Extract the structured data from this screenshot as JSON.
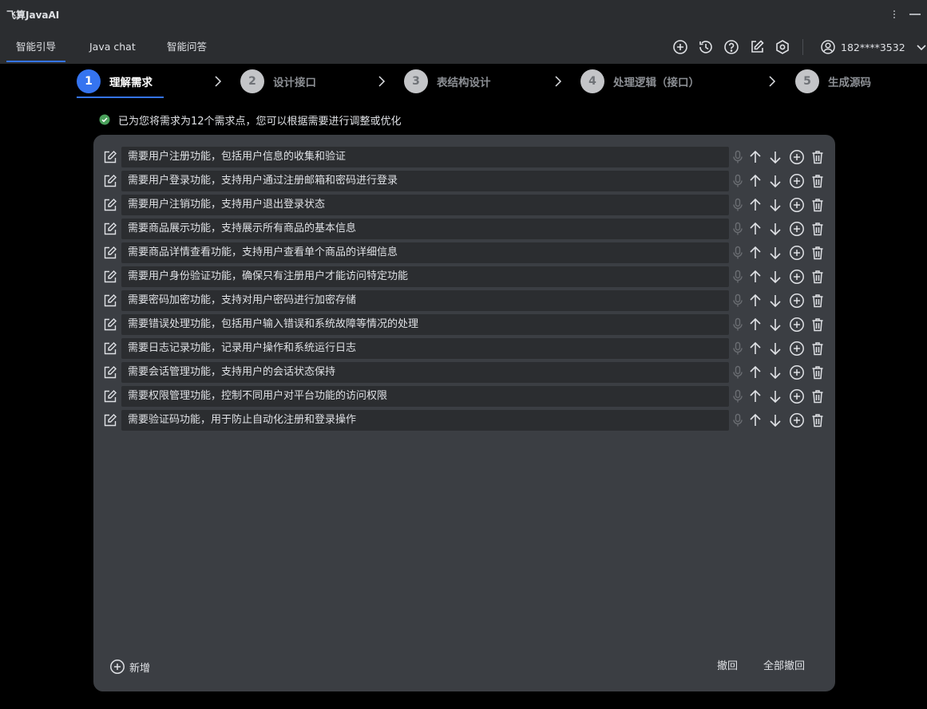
{
  "app": {
    "title": "飞算JavaAI"
  },
  "tabs": [
    {
      "label": "智能引导",
      "active": true
    },
    {
      "label": "Java chat",
      "active": false
    },
    {
      "label": "智能问答",
      "active": false
    }
  ],
  "toolbar_icons": [
    "plus-circle-icon",
    "history-icon",
    "help-icon",
    "edit-icon",
    "settings-icon"
  ],
  "user": {
    "account": "182****3532"
  },
  "steps": [
    {
      "num": "1",
      "label": "理解需求",
      "active": true
    },
    {
      "num": "2",
      "label": "设计接口",
      "active": false
    },
    {
      "num": "3",
      "label": "表结构设计",
      "active": false
    },
    {
      "num": "4",
      "label": "处理逻辑（接口）",
      "active": false
    },
    {
      "num": "5",
      "label": "生成源码",
      "active": false
    }
  ],
  "status": {
    "text": "已为您将需求为12个需求点，您可以根据需要进行调整或优化"
  },
  "requirements": [
    "需要用户注册功能，包括用户信息的收集和验证",
    "需要用户登录功能，支持用户通过注册邮箱和密码进行登录",
    "需要用户注销功能，支持用户退出登录状态",
    "需要商品展示功能，支持展示所有商品的基本信息",
    "需要商品详情查看功能，支持用户查看单个商品的详细信息",
    "需要用户身份验证功能，确保只有注册用户才能访问特定功能",
    "需要密码加密功能，支持对用户密码进行加密存储",
    "需要错误处理功能，包括用户输入错误和系统故障等情况的处理",
    "需要日志记录功能，记录用户操作和系统运行日志",
    "需要会话管理功能，支持用户的会话状态保持",
    "需要权限管理功能，控制不同用户对平台功能的访问权限",
    "需要验证码功能，用于防止自动化注册和登录操作"
  ],
  "footer": {
    "add_label": "新增",
    "undo_label": "撤回",
    "undo_all_label": "全部撤回"
  },
  "colors": {
    "accent": "#3574f0",
    "success": "#4aa05b",
    "panel": "#3b3e43",
    "input": "#2b2d30"
  }
}
